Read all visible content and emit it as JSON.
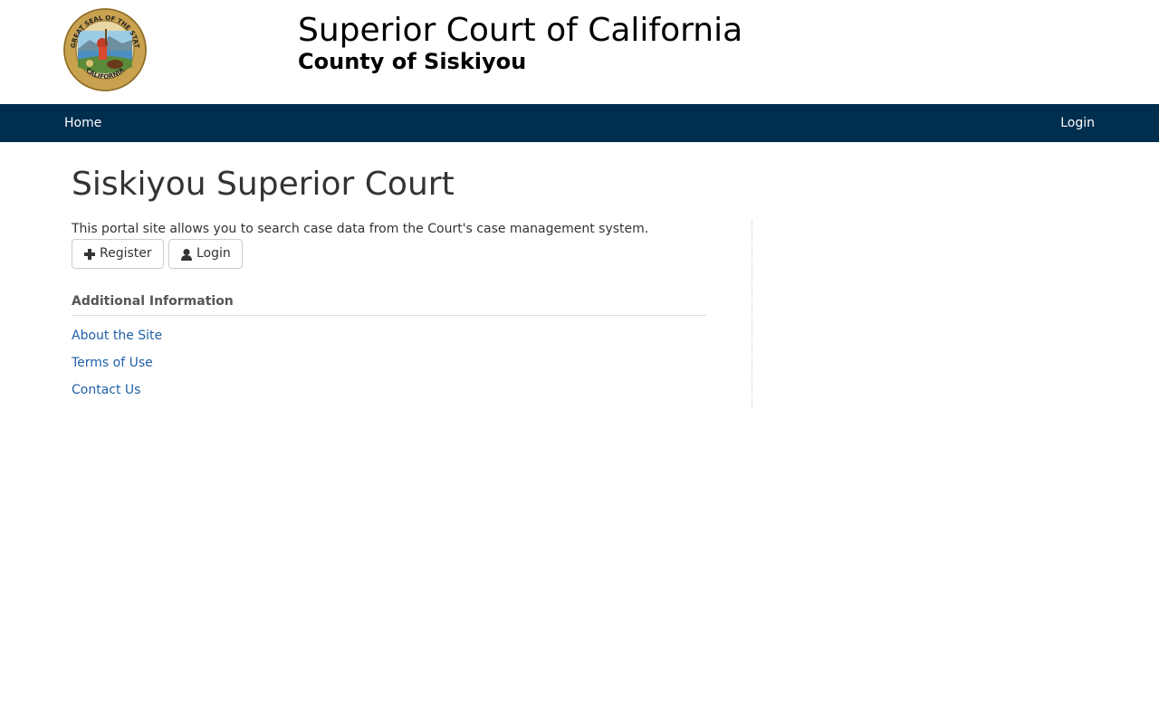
{
  "header": {
    "title": "Superior Court of California",
    "subtitle": "County of Siskiyou",
    "seal_icon": "california-state-seal"
  },
  "nav": {
    "home": "Home",
    "login": "Login"
  },
  "main": {
    "page_title": "Siskiyou Superior Court",
    "intro": "This portal site allows you to search case data from the Court's case management system.",
    "register_button": "Register",
    "register_icon": "plus-icon",
    "login_button": "Login",
    "login_icon": "user-icon",
    "additional_heading": "Additional Information",
    "links": {
      "about": "About the Site",
      "terms": "Terms of Use",
      "contact": "Contact Us"
    }
  },
  "colors": {
    "navbar": "#002e4f",
    "link": "#1f5fa6",
    "text": "#333333"
  }
}
